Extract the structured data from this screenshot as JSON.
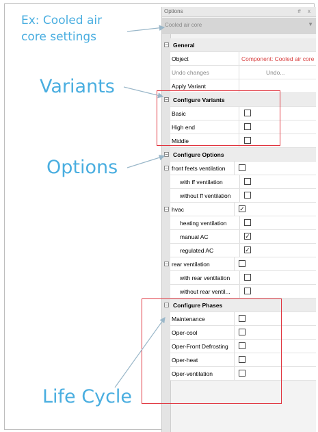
{
  "callouts": {
    "example": "Ex: Cooled air core settings",
    "example_line1": "Ex: Cooled air",
    "example_line2": "core settings",
    "variants": "Variants",
    "options": "Options",
    "life_cycle": "Life Cycle"
  },
  "panel": {
    "title": "Options",
    "title_icons": "# x",
    "object_selector": "Cooled air core",
    "selector_caret": "▼",
    "add_icon": "+",
    "general": {
      "heading": "General",
      "rows": [
        {
          "label": "Object",
          "value": "Component: Cooled air core"
        },
        {
          "label": "Undo changes",
          "value": "Undo..."
        },
        {
          "label": "Apply Variant",
          "value": ""
        }
      ]
    },
    "variants": {
      "heading": "Configure Variants",
      "items": [
        {
          "label": "Basic",
          "checked": false
        },
        {
          "label": "High end",
          "checked": false
        },
        {
          "label": "Middle",
          "checked": false
        }
      ]
    },
    "options": {
      "heading": "Configure Options",
      "items": [
        {
          "label": "front feets ventilation",
          "level": 0,
          "checked": false
        },
        {
          "label": "with ff ventilation",
          "level": 1,
          "checked": false
        },
        {
          "label": "without ff ventilation",
          "level": 1,
          "checked": false
        },
        {
          "label": "hvac",
          "level": 0,
          "checked": true
        },
        {
          "label": "heating ventilation",
          "level": 1,
          "checked": false
        },
        {
          "label": "manual AC",
          "level": 1,
          "checked": true
        },
        {
          "label": "regulated AC",
          "level": 1,
          "checked": true
        },
        {
          "label": "rear ventilation",
          "level": 0,
          "checked": false
        },
        {
          "label": "with rear ventilation",
          "level": 1,
          "checked": false
        },
        {
          "label": "without rear ventil...",
          "level": 1,
          "checked": false
        }
      ]
    },
    "phases": {
      "heading": "Configure Phases",
      "items": [
        {
          "label": "Maintenance",
          "checked": false
        },
        {
          "label": "Oper-cool",
          "checked": false
        },
        {
          "label": "Oper-Front Defrosting",
          "checked": false
        },
        {
          "label": "Oper-heat",
          "checked": false
        },
        {
          "label": "Oper-ventilation",
          "checked": false
        }
      ]
    },
    "toggle_minus": "−",
    "check_mark": "✓"
  }
}
